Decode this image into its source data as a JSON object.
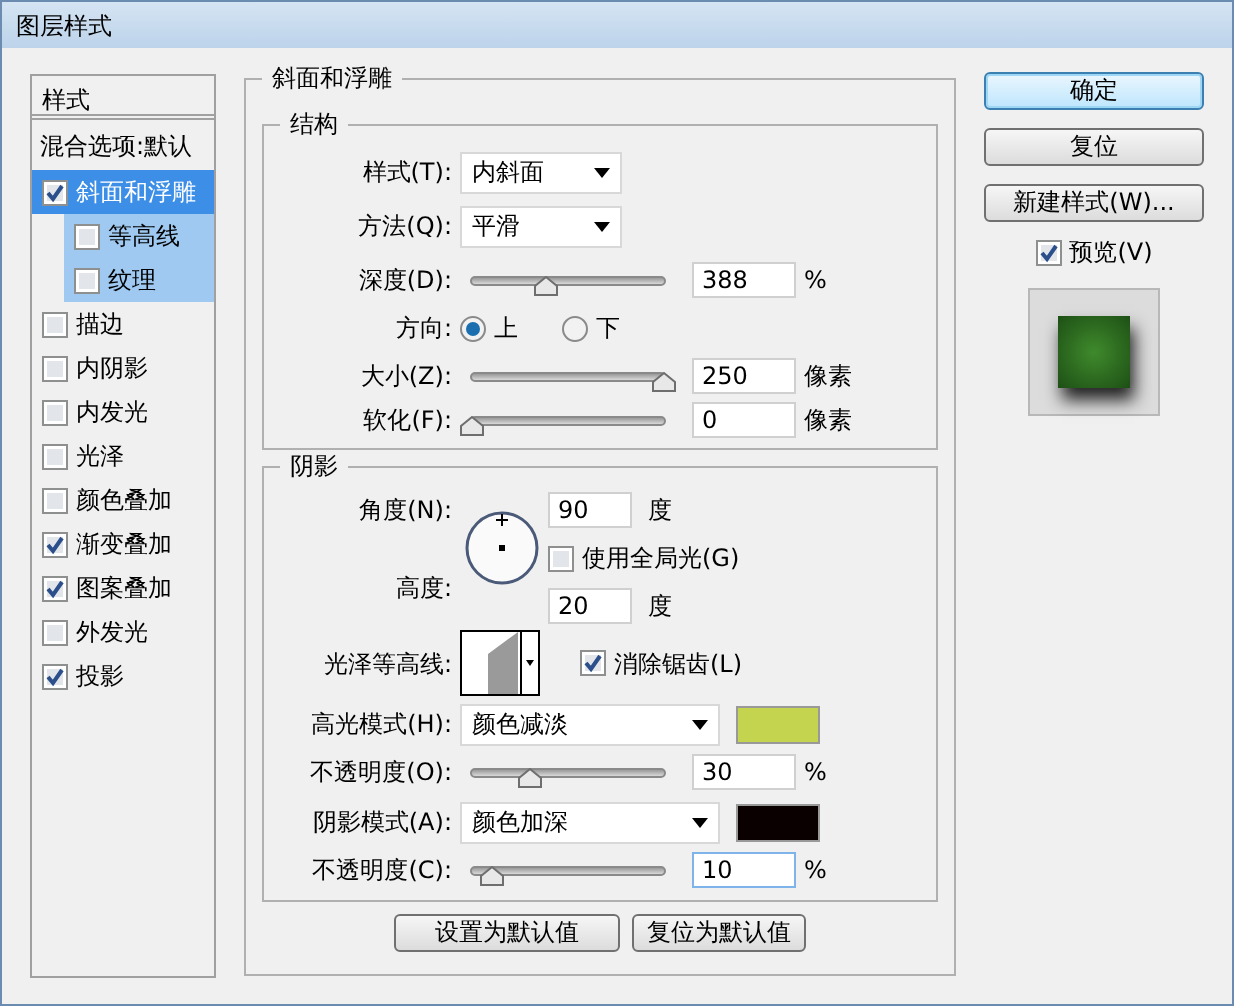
{
  "window": {
    "title": "图层样式"
  },
  "styles_list": {
    "header": "样式",
    "items": [
      {
        "label": "混合选项:默认",
        "kind": "plain",
        "selected": false
      },
      {
        "label": "斜面和浮雕",
        "kind": "check",
        "checked": true,
        "selected": true,
        "children": [
          {
            "label": "等高线",
            "checked": false,
            "selected": false
          },
          {
            "label": "纹理",
            "checked": false,
            "selected": false
          }
        ]
      },
      {
        "label": "描边",
        "kind": "check",
        "checked": false,
        "selected": false
      },
      {
        "label": "内阴影",
        "kind": "check",
        "checked": false,
        "selected": false
      },
      {
        "label": "内发光",
        "kind": "check",
        "checked": false,
        "selected": false
      },
      {
        "label": "光泽",
        "kind": "check",
        "checked": false,
        "selected": false
      },
      {
        "label": "颜色叠加",
        "kind": "check",
        "checked": false,
        "selected": false
      },
      {
        "label": "渐变叠加",
        "kind": "check",
        "checked": true,
        "selected": false
      },
      {
        "label": "图案叠加",
        "kind": "check",
        "checked": true,
        "selected": false
      },
      {
        "label": "外发光",
        "kind": "check",
        "checked": false,
        "selected": false
      },
      {
        "label": "投影",
        "kind": "check",
        "checked": true,
        "selected": false
      }
    ]
  },
  "bevel": {
    "title": "斜面和浮雕",
    "structure": {
      "title": "结构",
      "style": {
        "label": "样式(T):",
        "value": "内斜面"
      },
      "technique": {
        "label": "方法(Q):",
        "value": "平滑"
      },
      "depth": {
        "label": "深度(D):",
        "level": 0.388,
        "value": "388",
        "unit": "%"
      },
      "direction": {
        "label": "方向:",
        "options": [
          {
            "label": "上",
            "selected": true
          },
          {
            "label": "下",
            "selected": false
          }
        ]
      },
      "size": {
        "label": "大小(Z):",
        "level": 1,
        "value": "250",
        "unit": "像素"
      },
      "soften": {
        "label": "软化(F):",
        "level": 0,
        "value": "0",
        "unit": "像素"
      }
    },
    "shading": {
      "title": "阴影",
      "angle": {
        "label": "角度(N):",
        "value": "90",
        "unit": "度"
      },
      "global_light": {
        "label": "使用全局光(G)",
        "checked": false
      },
      "altitude": {
        "label": "高度:",
        "value": "20",
        "unit": "度"
      },
      "gloss_contour": {
        "label": "光泽等高线:"
      },
      "anti_aliased": {
        "label": "消除锯齿(L)",
        "checked": true
      },
      "highlight_mode": {
        "label": "高光模式(H):",
        "value": "颜色减淡",
        "color": "#c4d44e"
      },
      "highlight_opacity": {
        "label": "不透明度(O):",
        "level": 0.3,
        "value": "30",
        "unit": "%"
      },
      "shadow_mode": {
        "label": "阴影模式(A):",
        "value": "颜色加深",
        "color": "#0a0000"
      },
      "shadow_opacity": {
        "label": "不透明度(C):",
        "level": 0.1,
        "value": "10",
        "unit": "%",
        "focused": true
      }
    },
    "buttons": [
      "设置为默认值",
      "复位为默认值"
    ]
  },
  "actions": [
    {
      "label": "确定",
      "kind": "default"
    },
    {
      "label": "复位",
      "kind": "normal"
    },
    {
      "label": "新建样式(W)...",
      "kind": "normal"
    }
  ],
  "preview": {
    "label": "预览(V)",
    "checked": true
  }
}
